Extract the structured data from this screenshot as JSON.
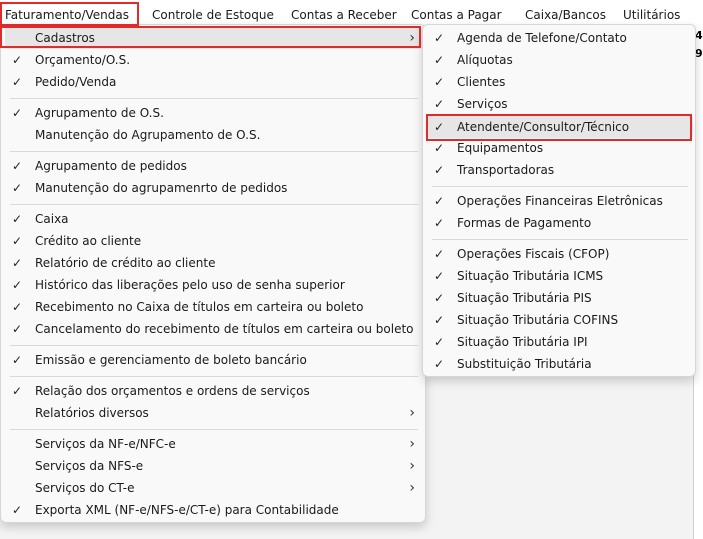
{
  "menubar": {
    "items": [
      "Faturamento/Vendas",
      "Controle de Estoque",
      "Contas a Receber",
      "Contas a Pagar",
      "Caixa/Bancos",
      "Utilitários"
    ]
  },
  "background": {
    "glyphs": [
      "4",
      "9"
    ]
  },
  "main_menu": {
    "groups": [
      [
        {
          "label": "Cadastros",
          "check": false,
          "submenu": true
        },
        {
          "label": "Orçamento/O.S.",
          "check": true,
          "submenu": false
        },
        {
          "label": "Pedido/Venda",
          "check": true,
          "submenu": false
        }
      ],
      [
        {
          "label": "Agrupamento de O.S.",
          "check": true,
          "submenu": false
        },
        {
          "label": "Manutenção do Agrupamento de O.S.",
          "check": false,
          "submenu": false
        }
      ],
      [
        {
          "label": "Agrupamento de pedidos",
          "check": true,
          "submenu": false
        },
        {
          "label": "Manutenção do agrupamenrto de pedidos",
          "check": true,
          "submenu": false
        }
      ],
      [
        {
          "label": "Caixa",
          "check": true,
          "submenu": false
        },
        {
          "label": "Crédito ao cliente",
          "check": true,
          "submenu": false
        },
        {
          "label": "Relatório de crédito ao cliente",
          "check": true,
          "submenu": false
        },
        {
          "label": "Histórico das liberações pelo uso de senha superior",
          "check": true,
          "submenu": false
        },
        {
          "label": "Recebimento no Caixa de títulos em carteira ou boleto",
          "check": true,
          "submenu": false
        },
        {
          "label": "Cancelamento do recebimento de títulos em carteira ou boleto",
          "check": true,
          "submenu": false
        }
      ],
      [
        {
          "label": "Emissão e gerenciamento de boleto bancário",
          "check": true,
          "submenu": false
        }
      ],
      [
        {
          "label": "Relação dos orçamentos e ordens de serviços",
          "check": true,
          "submenu": false
        },
        {
          "label": "Relatórios diversos",
          "check": false,
          "submenu": true
        }
      ],
      [
        {
          "label": "Serviços da NF-e/NFC-e",
          "check": false,
          "submenu": true
        },
        {
          "label": "Serviços da NFS-e",
          "check": false,
          "submenu": true
        },
        {
          "label": "Serviços do CT-e",
          "check": false,
          "submenu": true
        },
        {
          "label": "Exporta XML (NF-e/NFS-e/CT-e) para Contabilidade",
          "check": true,
          "submenu": false
        }
      ]
    ]
  },
  "sub_menu": {
    "groups": [
      [
        {
          "label": "Agenda de Telefone/Contato",
          "check": true
        },
        {
          "label": "Alíquotas",
          "check": true
        },
        {
          "label": "Clientes",
          "check": true
        },
        {
          "label": "Serviços",
          "check": true
        },
        {
          "label": "Atendente/Consultor/Técnico",
          "check": true
        },
        {
          "label": "Equipamentos",
          "check": true
        },
        {
          "label": "Transportadoras",
          "check": true
        }
      ],
      [
        {
          "label": "Operações Financeiras Eletrônicas",
          "check": true
        },
        {
          "label": "Formas de Pagamento",
          "check": true
        }
      ],
      [
        {
          "label": "Operações Fiscais (CFOP)",
          "check": true
        },
        {
          "label": "Situação Tributária ICMS",
          "check": true
        },
        {
          "label": "Situação Tributária PIS",
          "check": true
        },
        {
          "label": "Situação Tributária COFINS",
          "check": true
        },
        {
          "label": "Situação Tributária IPI",
          "check": true
        },
        {
          "label": "Substituição Tributária",
          "check": true
        }
      ]
    ]
  },
  "highlight_color": "#e02b2b",
  "icons": {
    "check": "check-icon",
    "submenu": "chevron-right-icon"
  }
}
